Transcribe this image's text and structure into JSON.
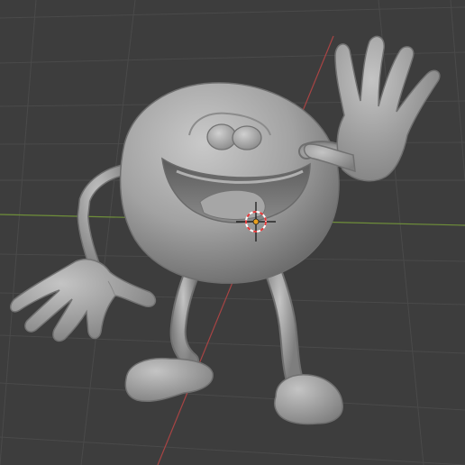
{
  "viewport": {
    "background": "#3d3d3d",
    "grid_color": "#484848",
    "x_axis_color": "#7a9a40",
    "y_axis_color": "#b24848",
    "model_color": "#a8a8a8",
    "cursor_colors": [
      "#e83838",
      "#ffffff"
    ],
    "origin_color": "#e8a020"
  }
}
